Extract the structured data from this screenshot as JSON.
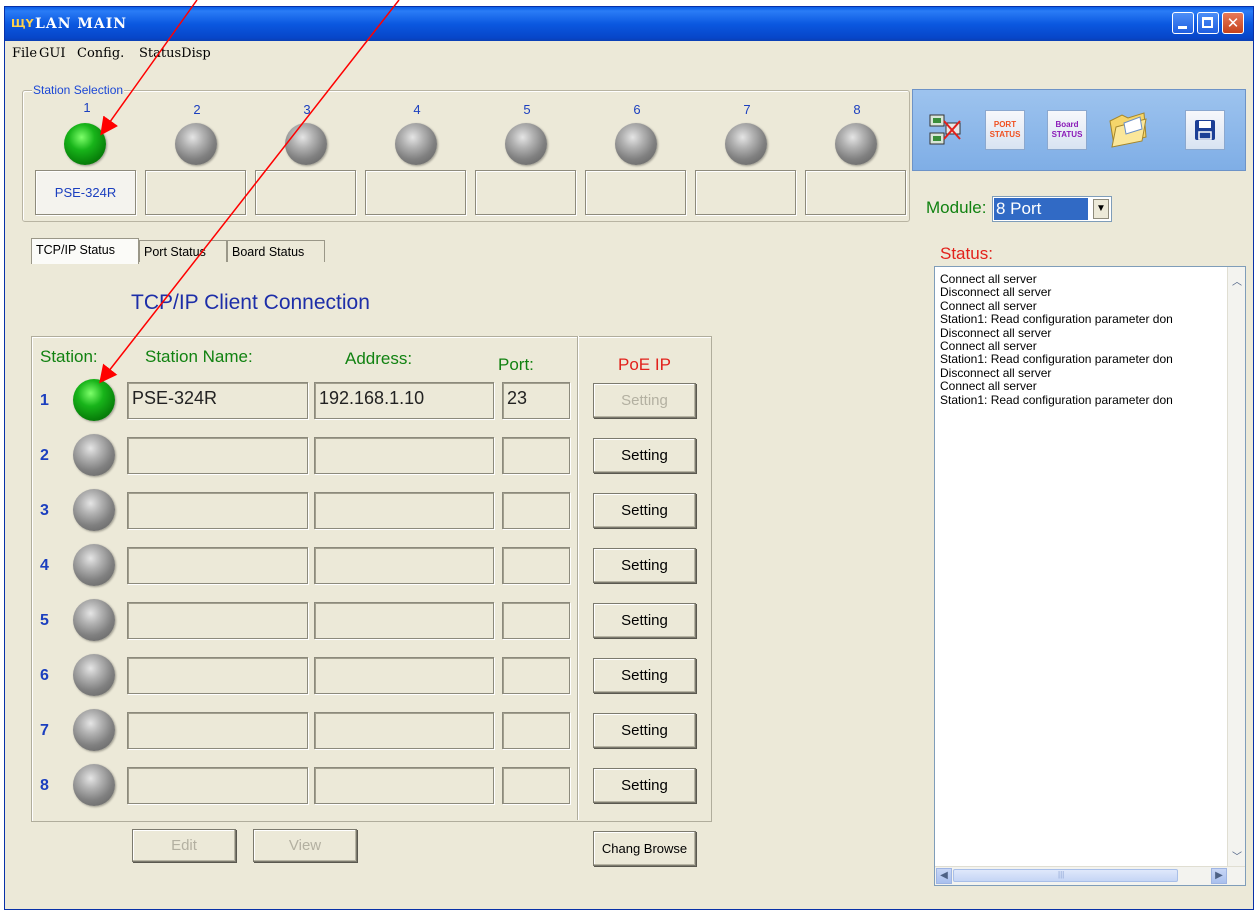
{
  "window": {
    "title": "LAN MAIN",
    "icon_text": "ЩҮ"
  },
  "menu": [
    "File",
    "GUI",
    "Config.",
    "StatusDisp"
  ],
  "station_selection": {
    "label": "Station Selection",
    "numbers": [
      "1",
      "2",
      "3",
      "4",
      "5",
      "6",
      "7",
      "8"
    ],
    "leds": [
      "green",
      "gray",
      "gray",
      "gray",
      "gray",
      "gray",
      "gray",
      "gray"
    ],
    "slot_names": [
      "PSE-324R",
      "",
      "",
      "",
      "",
      "",
      "",
      ""
    ]
  },
  "toolbar": {
    "items": [
      {
        "name": "connection-icon",
        "label": ""
      },
      {
        "name": "port-status-icon",
        "label": "PORT STATUS"
      },
      {
        "name": "board-status-icon",
        "label": "Board STATUS"
      },
      {
        "name": "open-folder-icon",
        "label": ""
      },
      {
        "name": "save-icon",
        "label": ""
      }
    ]
  },
  "module": {
    "label": "Module:",
    "value": "8 Port"
  },
  "status": {
    "label": "Status:",
    "lines": [
      "Connect all server",
      "Disconnect all server",
      "Connect all server",
      "Station1: Read configuration parameter don",
      "Disconnect all server",
      "Connect all server",
      "Station1: Read configuration parameter don",
      "Disconnect all server",
      "Connect all server",
      "Station1: Read configuration parameter don"
    ]
  },
  "tabs": [
    "TCP/IP Status",
    "Port Status",
    "Board Status"
  ],
  "tcp": {
    "title": "TCP/IP Client Connection",
    "headers": {
      "station": "Station:",
      "name": "Station Name:",
      "address": "Address:",
      "port": "Port:",
      "poe_ip": "PoE IP"
    },
    "rows": [
      {
        "num": "1",
        "led": "green",
        "name": "PSE-324R",
        "address": "192.168.1.10",
        "port": "23",
        "button": "Setting",
        "enabled": false
      },
      {
        "num": "2",
        "led": "gray",
        "name": "",
        "address": "",
        "port": "",
        "button": "Setting",
        "enabled": true
      },
      {
        "num": "3",
        "led": "gray",
        "name": "",
        "address": "",
        "port": "",
        "button": "Setting",
        "enabled": true
      },
      {
        "num": "4",
        "led": "gray",
        "name": "",
        "address": "",
        "port": "",
        "button": "Setting",
        "enabled": true
      },
      {
        "num": "5",
        "led": "gray",
        "name": "",
        "address": "",
        "port": "",
        "button": "Setting",
        "enabled": true
      },
      {
        "num": "6",
        "led": "gray",
        "name": "",
        "address": "",
        "port": "",
        "button": "Setting",
        "enabled": true
      },
      {
        "num": "7",
        "led": "gray",
        "name": "",
        "address": "",
        "port": "",
        "button": "Setting",
        "enabled": true
      },
      {
        "num": "8",
        "led": "gray",
        "name": "",
        "address": "",
        "port": "",
        "button": "Setting",
        "enabled": true
      }
    ],
    "edit_label": "Edit",
    "view_label": "View",
    "browse_label": "Chang Browse"
  },
  "colors": {
    "annotation_arrow": "#ff0000",
    "header_green": "#118211",
    "header_red": "#e2211b",
    "title_blue": "#1d2ea8"
  }
}
